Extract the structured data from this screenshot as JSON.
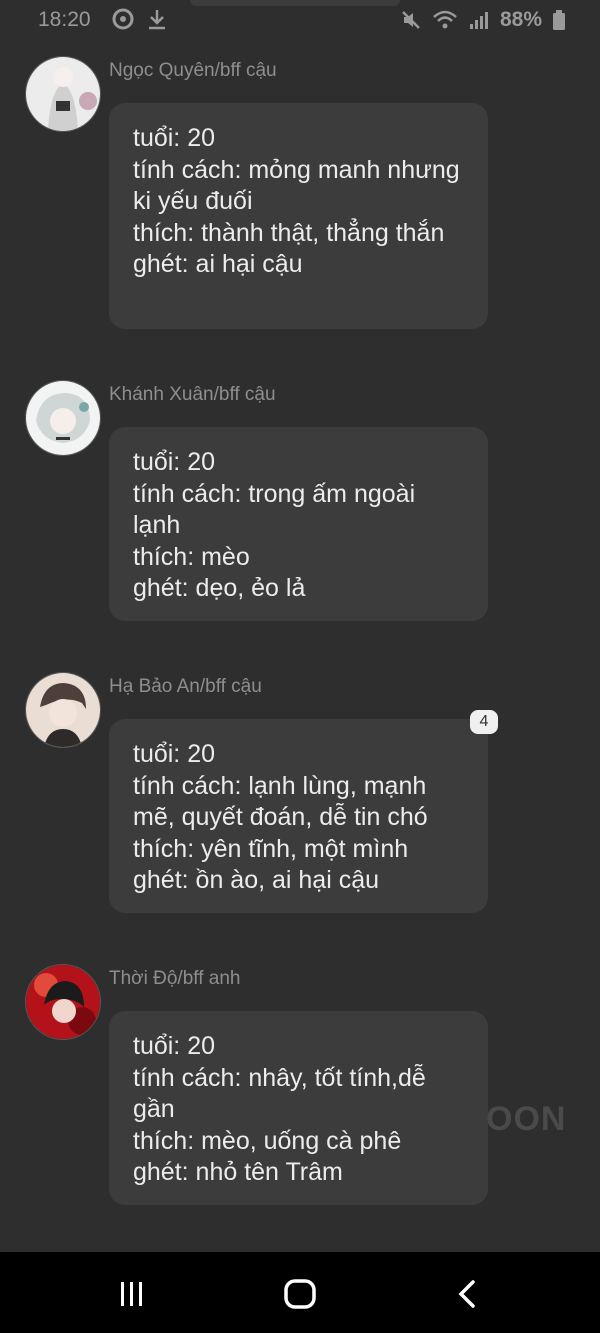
{
  "status": {
    "time": "18:20",
    "battery": "88%",
    "icons_left": [
      "sync-icon",
      "download-icon"
    ],
    "icons_right": [
      "mute-icon",
      "wifi-icon",
      "signal-icon",
      "battery-icon"
    ]
  },
  "messages": [
    {
      "name": "Ngọc Quyên/bff cậu",
      "lines": [
        "tuổi: 20",
        "tính cách: mỏng manh nhưng ki yếu đuối",
        "thích: thành thật, thẳng thắn",
        "ghét: ai hại cậu"
      ],
      "avatar_colors": [
        "#f1f1f1",
        "#d9d9d9",
        "#c9a8b5"
      ]
    },
    {
      "name": "Khánh Xuân/bff cậu",
      "lines": [
        "tuổi: 20",
        "tính cách: trong ấm ngoài lạnh",
        "thích: mèo",
        "ghét: dẹo, ẻo lả"
      ],
      "avatar_colors": [
        "#eef2f2",
        "#c9d1d1",
        "#7aa9a5"
      ]
    },
    {
      "name": "Hạ Bảo An/bff cậu",
      "lines": [
        "tuổi: 20",
        "tính cách: lạnh lùng, mạnh mẽ, quyết đoán, dễ tin chó",
        "thích: yên tĩnh, một mình",
        "ghét: ồn ào, ai hại cậu"
      ],
      "avatar_colors": [
        "#e8dcd3",
        "#5b4a45",
        "#2f2a2a"
      ]
    },
    {
      "name": "Thời Độ/bff anh",
      "lines": [
        "tuổi: 20",
        "tính cách: nhây, tốt tính,dễ gần",
        "thích: mèo, uống cà phê",
        "ghét: nhỏ tên Trâm"
      ],
      "avatar_colors": [
        "#b3121b",
        "#1b1b1b",
        "#e24a3a"
      ]
    }
  ],
  "badge": "4",
  "watermark": "OON"
}
